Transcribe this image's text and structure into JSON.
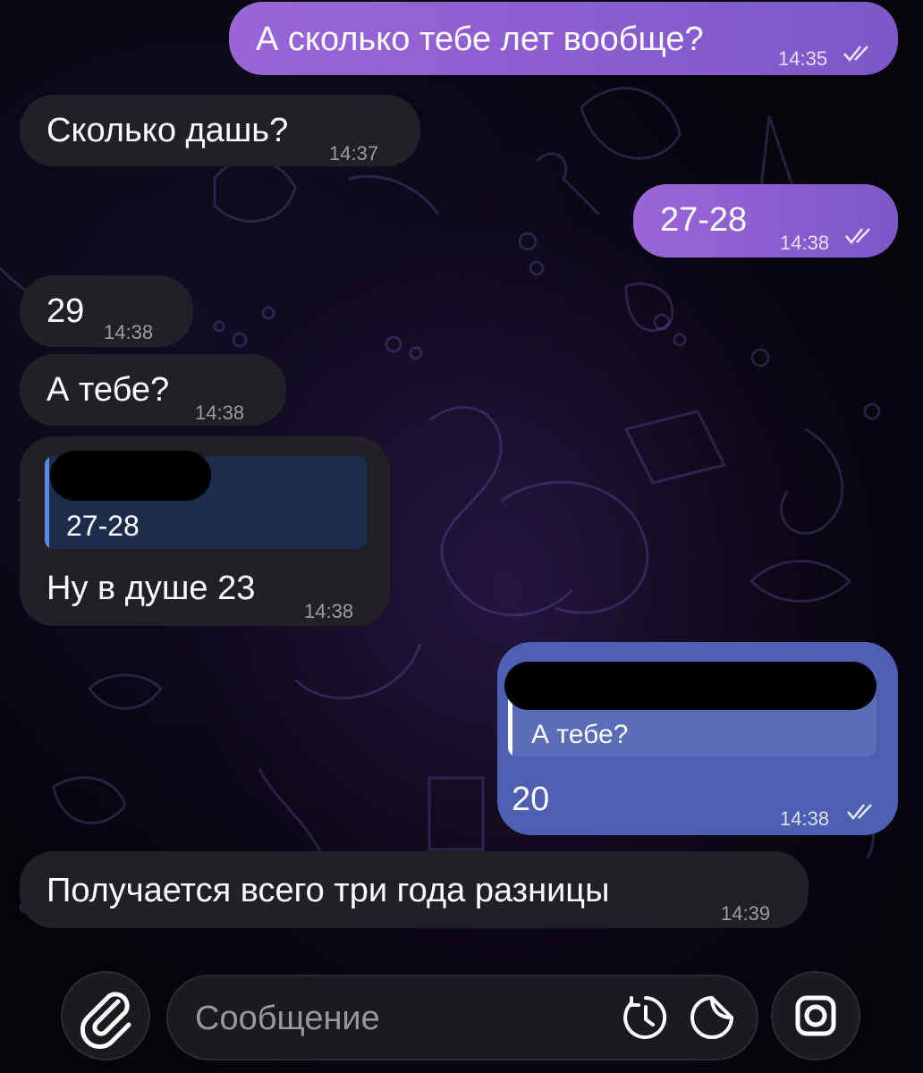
{
  "messages": [
    {
      "id": "m1",
      "direction": "outgoing",
      "text": "А сколько тебе лет вообще?",
      "time": "14:35",
      "read": true
    },
    {
      "id": "m2",
      "direction": "incoming",
      "text": "Сколько дашь?",
      "time": "14:37"
    },
    {
      "id": "m3",
      "direction": "outgoing",
      "text": "27-28",
      "time": "14:38",
      "read": true
    },
    {
      "id": "m4",
      "direction": "incoming",
      "text": "29",
      "time": "14:38"
    },
    {
      "id": "m5",
      "direction": "incoming",
      "text": "А тебе?",
      "time": "14:38"
    },
    {
      "id": "m6",
      "direction": "incoming",
      "text": "Ну в душе 23",
      "time": "14:38",
      "reply_to_text": "27-28"
    },
    {
      "id": "m7",
      "direction": "outgoing",
      "text": "20",
      "time": "14:38",
      "read": true,
      "reply_to_text": "А тебе?"
    },
    {
      "id": "m8",
      "direction": "incoming",
      "text": "Получается всего три года разницы",
      "time": "14:39"
    }
  ],
  "composer": {
    "placeholder": "Сообщение",
    "attach_icon": "paperclip-icon",
    "timer_icon": "timer-icon",
    "sticker_icon": "sticker-icon",
    "camera_icon": "camera-icon"
  },
  "colors": {
    "outgoing_bubble": "#8c5ed0",
    "outgoing_reply_bubble": "#4d5fb0",
    "incoming_bubble": "#221f27",
    "background": "#06040a"
  }
}
